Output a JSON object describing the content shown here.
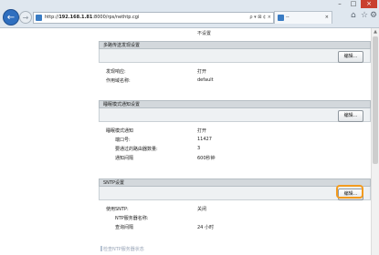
{
  "browser": {
    "url_prefix": "http://",
    "url_host": "192.168.1.81",
    "url_path": ":8000/rps/nethtp.cgi",
    "address_tools": "ρ ▾ ⊠ ¢ ×",
    "tab_title": "--",
    "tab_close": "×",
    "back_icon": "←",
    "forward_icon": "→",
    "win_min": "–",
    "win_max": "□",
    "win_close": "×"
  },
  "page": {
    "top_partial": {
      "label": "",
      "value": "不设置"
    },
    "sections": [
      {
        "title": "多路传送发现设置",
        "edit_label": "编辑...",
        "rows": [
          {
            "label": "发现响应:",
            "value": "打开"
          },
          {
            "label": "作用域名称:",
            "value": "default"
          }
        ]
      },
      {
        "title": "睡眠模式通知设置",
        "edit_label": "编辑...",
        "rows": [
          {
            "label": "睡眠模式通知",
            "value": "打开"
          },
          {
            "label": "端口号:",
            "value": "11427"
          },
          {
            "label": "要通过的路由器数量:",
            "value": "3"
          },
          {
            "label": "通知间隔",
            "value": "600秒钟"
          }
        ]
      },
      {
        "title": "SNTP设置",
        "edit_label": "编辑...",
        "rows": [
          {
            "label": "使用SNTP:",
            "value": "关闭"
          },
          {
            "label": "NTP服务器名称:",
            "value": ""
          },
          {
            "label": "查询间隔",
            "value": "24 小时"
          }
        ]
      }
    ],
    "bottom_link": "检查NTP服务器状态"
  }
}
